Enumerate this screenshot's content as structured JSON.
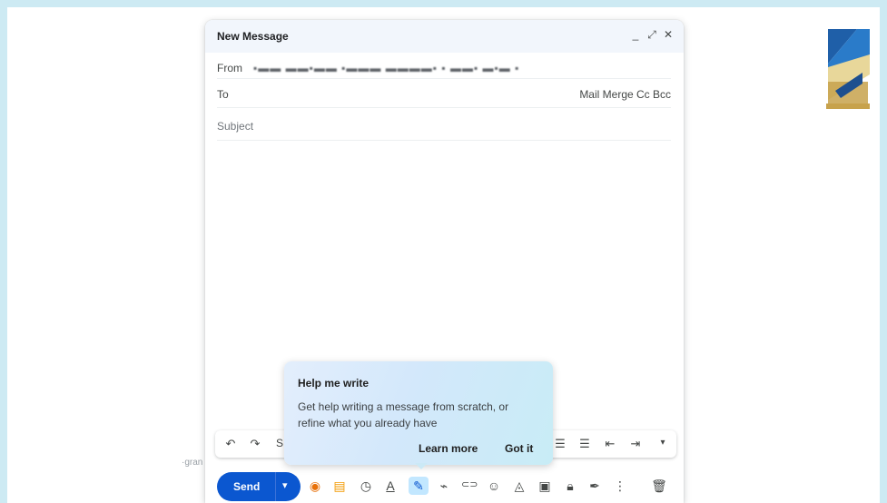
{
  "compose": {
    "title": "New Message",
    "header_icons": [
      "_",
      "⤢",
      "✕"
    ],
    "from_label": "From",
    "from_value": "▪▬▬ ▬▬▪▬▬ ▪▬▬▬ ▬▬▬▬▪ ▪ ▬▬▪ ▬▪▬ ▪",
    "to_label": "To",
    "to_extras": "Mail Merge  Cc  Bcc",
    "subject_placeholder": "Subject",
    "format_partial_label": "S"
  },
  "format_bar": {
    "icons": [
      "undo-icon",
      "redo-icon",
      "bulleted-list-icon",
      "numbered-list-icon",
      "indent-less-icon",
      "indent-more-icon",
      "more-formatting-icon"
    ]
  },
  "bottom_bar": {
    "send_label": "Send",
    "icons": [
      "tracking-eye-icon",
      "template-icon",
      "schedule-icon",
      "text-color-icon",
      "help-me-write-icon",
      "attach-icon",
      "link-icon",
      "emoji-icon",
      "drive-icon",
      "photo-icon",
      "confidential-lock-icon",
      "signature-icon",
      "more-options-icon",
      "trash-icon"
    ]
  },
  "popup": {
    "title": "Help me write",
    "body": "Get help writing a message from scratch, or refine what you already have",
    "learn_more": "Learn more",
    "got_it": "Got it"
  },
  "background": {
    "side_text": "·gran"
  },
  "colors": {
    "send_blue": "#0b57d0",
    "header_bg": "#f2f6fc",
    "page_border": "#cdeaf3"
  }
}
